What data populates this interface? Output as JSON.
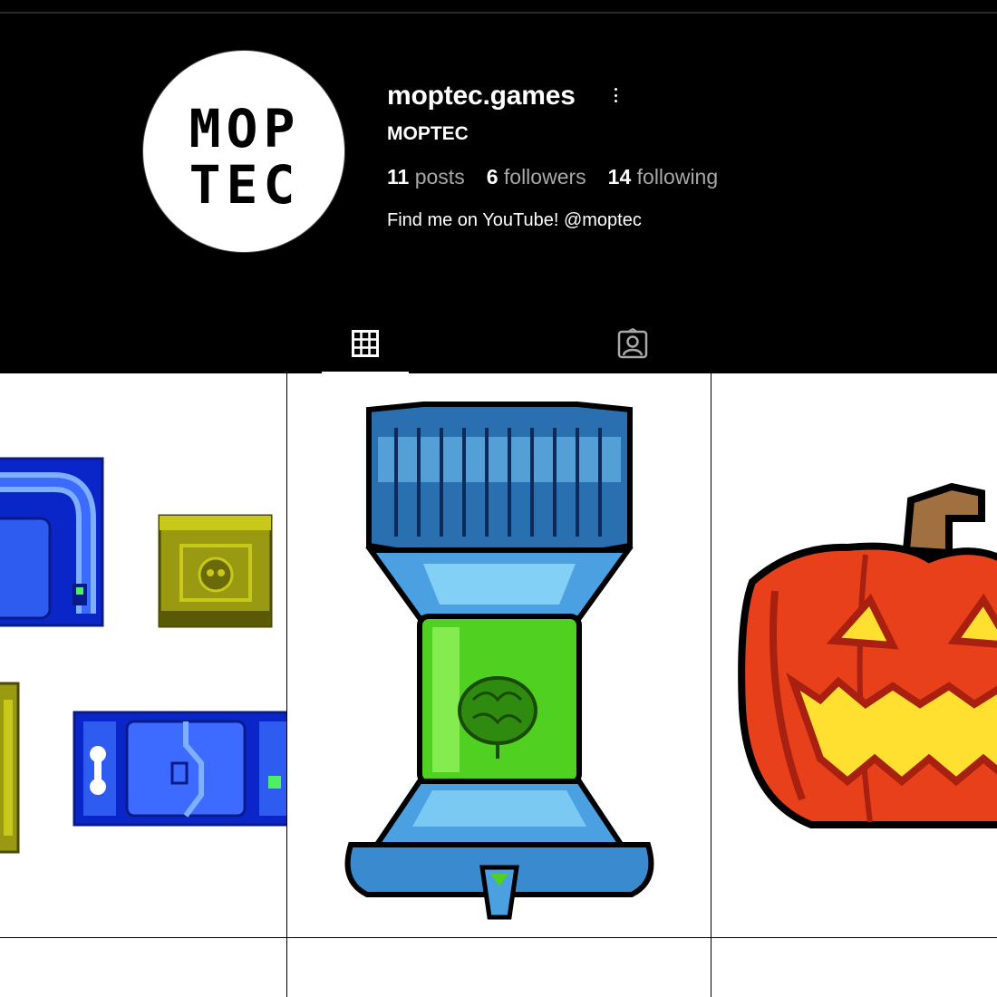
{
  "profile": {
    "logo_line1": "MOP",
    "logo_line2": "TEC",
    "username": "moptec.games",
    "full_name": "MOPTEC",
    "stats": [
      {
        "count": "11",
        "label": "posts"
      },
      {
        "count": "6",
        "label": "followers"
      },
      {
        "count": "14",
        "label": "following"
      }
    ],
    "bio": "Find me on YouTube! @moptec"
  },
  "icons": {
    "more": "more-options-icon",
    "grid_tab": "grid-icon",
    "tagged_tab": "tagged-portrait-icon"
  },
  "tabs": {
    "active": "posts"
  },
  "posts": [
    {
      "name": "sci-fi-tiles-post",
      "description": "pixel art blue and yellow sci-fi tiles"
    },
    {
      "name": "brain-tank-post",
      "description": "pixel art brain in green tank"
    },
    {
      "name": "pumpkin-post",
      "description": "pixel art jack-o-lantern"
    }
  ],
  "colors": {
    "background": "#000000",
    "text": "#ffffff",
    "muted_text": "#a8a8a8"
  }
}
